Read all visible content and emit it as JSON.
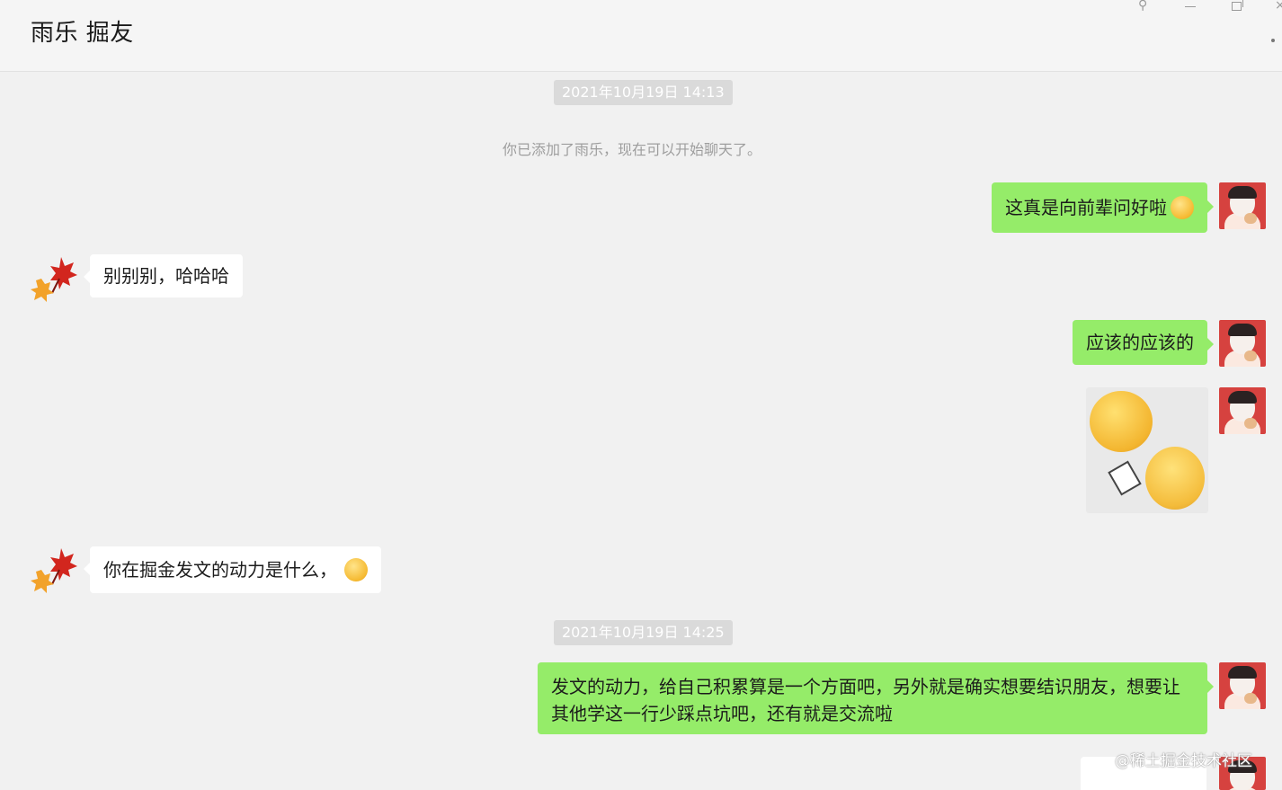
{
  "window": {
    "title": "雨乐 掘友",
    "controls": {
      "pin": "⚲",
      "close": "×"
    }
  },
  "timestamps": [
    "2021年10月19日 14:13",
    "2021年10月19日 14:25"
  ],
  "system_message": "你已添加了雨乐，现在可以开始聊天了。",
  "messages": [
    {
      "sender": "self",
      "type": "text",
      "text": "这真是向前辈问好啦",
      "emoji": "wink-emoji-icon"
    },
    {
      "sender": "other",
      "type": "text",
      "text": "别别别，哈哈哈"
    },
    {
      "sender": "self",
      "type": "text",
      "text": "应该的应该的"
    },
    {
      "sender": "self",
      "type": "sticker",
      "sticker": "yawn-and-smug-sticker"
    },
    {
      "sender": "other",
      "type": "text",
      "text": "你在掘金发文的动力是什么，",
      "emoji": "laugh-cry-emoji-icon"
    },
    {
      "sender": "self",
      "type": "text",
      "text": "发文的动力，给自己积累算是一个方面吧，另外就是确实想要结识朋友，想要让其他学这一行少踩点坑吧，还有就是交流啦"
    }
  ],
  "colors": {
    "self_bubble": "#95ec69",
    "other_bubble": "#ffffff",
    "background": "#f1f1f1",
    "timestamp_bg": "#dadada"
  },
  "watermark": "@稀土掘金技术社区"
}
